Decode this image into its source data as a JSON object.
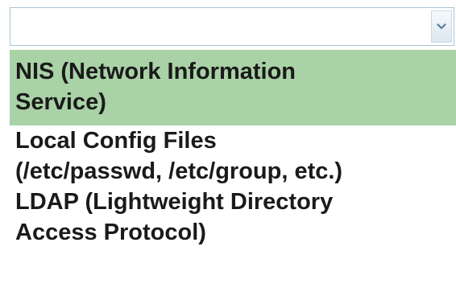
{
  "select": {
    "value": "",
    "arrow_icon": "chevron-down-icon"
  },
  "options": [
    {
      "lines": [
        "NIS (Network Information",
        "Service)"
      ],
      "selected": true
    },
    {
      "lines": [
        "Local Config Files",
        "(/etc/passwd, /etc/group, etc.)"
      ],
      "selected": false
    },
    {
      "lines": [
        "LDAP (Lightweight Directory",
        "Access Protocol)"
      ],
      "selected": false
    }
  ],
  "colors": {
    "highlight": "#a9d2a6",
    "select_border": "#a9c3d4",
    "text": "#1a1a1a"
  }
}
